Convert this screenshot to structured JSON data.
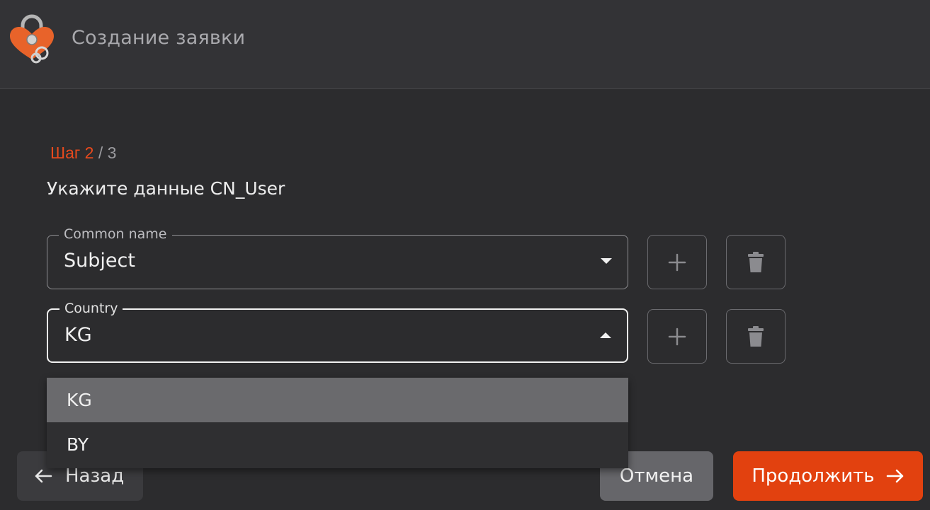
{
  "header": {
    "title": "Создание заявки",
    "logo_icon": "padlock-heart-icon"
  },
  "step": {
    "current_label": "Шаг 2",
    "separator": "/",
    "total": "3"
  },
  "subtitle": "Укажите данные CN_User",
  "fields": [
    {
      "label": "Common name",
      "value": "Subject",
      "state": "collapsed"
    },
    {
      "label": "Country",
      "value": "KG",
      "state": "expanded"
    }
  ],
  "dropdown": {
    "options": [
      "KG",
      "BY"
    ],
    "selected": "KG"
  },
  "icons": {
    "add": "plus-icon",
    "delete": "trash-icon",
    "back": "arrow-left-icon",
    "forward": "arrow-right-icon"
  },
  "buttons": {
    "back_label": "Назад",
    "cancel_label": "Отмена",
    "continue_label": "Продолжить"
  },
  "colors": {
    "accent": "#e2410f",
    "step_accent": "#e84a1d",
    "background": "#2c2c2e",
    "header_bg": "#333336"
  }
}
